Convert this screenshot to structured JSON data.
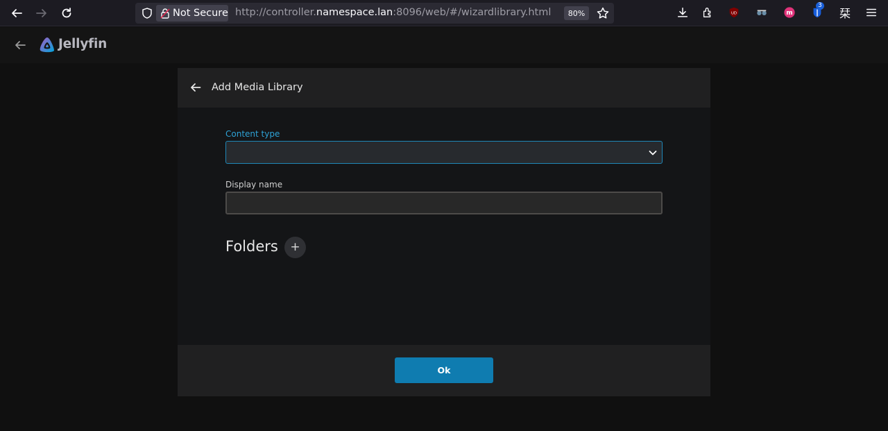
{
  "browser": {
    "not_secure_label": "Not Secure",
    "url_prefix": "http://controller.",
    "url_host": "namespace.lan",
    "url_suffix": ":8096/web/#/wizardlibrary.html",
    "zoom_level": "80%",
    "extension_badge": "3",
    "extension_glyph": "栞",
    "icons": [
      "back-icon",
      "forward-icon",
      "reload-icon",
      "shield-icon",
      "lock-icon",
      "star-icon",
      "download-icon",
      "extensions-icon",
      "ublock-icon",
      "privacy-icon",
      "extension-m-icon",
      "bitwarden-icon",
      "menu-icon"
    ]
  },
  "app": {
    "brand": "Jellyfin",
    "colors": {
      "accent": "#00a4dc",
      "brand_purple": "#aa5cc3"
    }
  },
  "dialog": {
    "title": "Add Media Library",
    "content_type_label": "Content type",
    "content_type_value": "",
    "display_name_label": "Display name",
    "display_name_value": "",
    "folders_heading": "Folders",
    "add_folder_glyph": "+",
    "ok_label": "Ok"
  }
}
